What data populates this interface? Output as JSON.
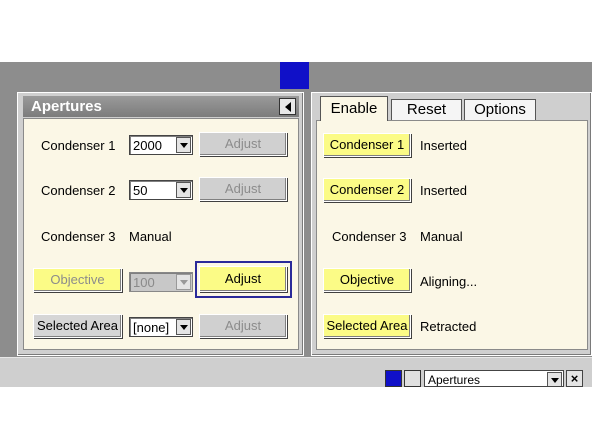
{
  "apertures_panel": {
    "title": "Apertures",
    "rows": [
      {
        "label": "Condenser 1",
        "select_value": "2000",
        "button_label": "Adjust"
      },
      {
        "label": "Condenser 2",
        "select_value": "50",
        "button_label": "Adjust"
      },
      {
        "label": "Condenser 3",
        "value": "Manual"
      },
      {
        "button_label": "Objective",
        "select_value": "100",
        "adjust_label": "Adjust"
      },
      {
        "button_label": "Selected Area",
        "select_value": "[none]",
        "adjust_label": "Adjust"
      }
    ]
  },
  "tabs": [
    {
      "label": "Enable",
      "active": true
    },
    {
      "label": "Reset",
      "active": false
    },
    {
      "label": "Options",
      "active": false
    }
  ],
  "status_panel": {
    "rows": [
      {
        "button_label": "Condenser 1",
        "status": "Inserted"
      },
      {
        "button_label": "Condenser 2",
        "status": "Inserted"
      },
      {
        "label": "Condenser 3",
        "status": "Manual"
      },
      {
        "button_label": "Objective",
        "status": "Aligning..."
      },
      {
        "button_label": "Selected Area",
        "status": "Retracted"
      }
    ]
  },
  "bottom_bar": {
    "combo_value": "Apertures",
    "close_glyph": "×"
  },
  "colors": {
    "yellow_button": "#fbfb86",
    "panel_body": "#fbf7e6",
    "app_background": "#8d8d8d",
    "accent_blue": "#1010c8"
  }
}
